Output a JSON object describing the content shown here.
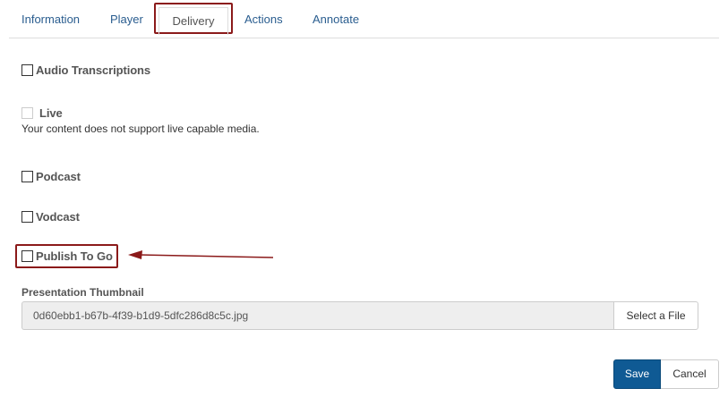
{
  "tabs": [
    {
      "label": "Information"
    },
    {
      "label": "Player"
    },
    {
      "label": "Delivery"
    },
    {
      "label": "Actions"
    },
    {
      "label": "Annotate"
    }
  ],
  "active_tab": "Delivery",
  "options": {
    "audio_transcriptions": {
      "label": "Audio Transcriptions",
      "checked": false
    },
    "live": {
      "label": "Live",
      "checked": false,
      "disabled": true,
      "helper": "Your content does not support live capable media."
    },
    "podcast": {
      "label": "Podcast",
      "checked": false
    },
    "vodcast": {
      "label": "Vodcast",
      "checked": false
    },
    "publish_to_go": {
      "label": "Publish To Go",
      "checked": false
    }
  },
  "thumbnail": {
    "label": "Presentation Thumbnail",
    "filename": "0d60ebb1-b67b-4f39-b1d9-5dfc286d8c5c.jpg",
    "select_label": "Select a File"
  },
  "actions": {
    "save_label": "Save",
    "cancel_label": "Cancel"
  },
  "colors": {
    "link": "#2a5d8f",
    "primary": "#0f5a94",
    "annotation": "#8b1a1a"
  }
}
